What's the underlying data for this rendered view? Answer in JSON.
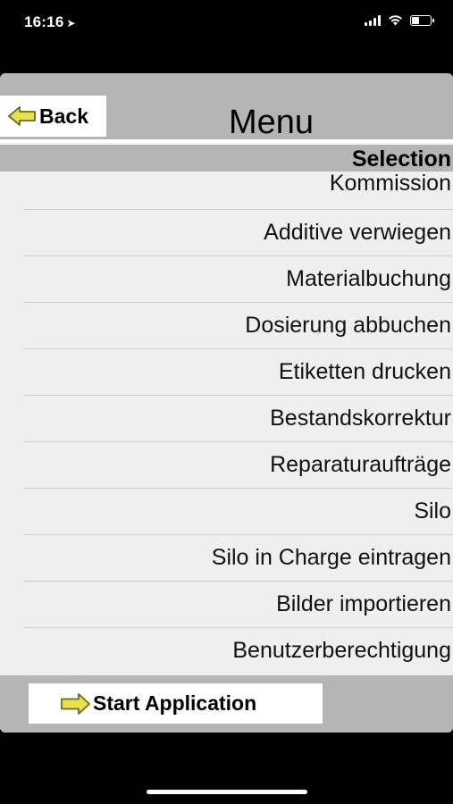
{
  "status_bar": {
    "time": "16:16",
    "location_icon": "location-arrow-icon",
    "icons": [
      "cellular-signal-icon",
      "wifi-icon",
      "battery-icon"
    ]
  },
  "header": {
    "back_label": "Back",
    "back_icon": "arrow-left-icon",
    "title": "Menu"
  },
  "section": {
    "label": "Selection"
  },
  "menu": {
    "items": [
      {
        "label": "Kommission"
      },
      {
        "label": "Additive verwiegen"
      },
      {
        "label": "Materialbuchung"
      },
      {
        "label": "Dosierung abbuchen"
      },
      {
        "label": "Etiketten drucken"
      },
      {
        "label": "Bestandskorrektur"
      },
      {
        "label": "Reparaturaufträge"
      },
      {
        "label": "Silo"
      },
      {
        "label": "Silo in Charge eintragen"
      },
      {
        "label": "Bilder importieren"
      },
      {
        "label": "Benutzerberechtigung"
      }
    ]
  },
  "footer": {
    "start_label": "Start Application",
    "start_icon": "arrow-right-icon"
  },
  "colors": {
    "header_gray": "#b5b5b5",
    "panel_bg": "#efefef",
    "arrow_yellow": "#e6e24a"
  }
}
